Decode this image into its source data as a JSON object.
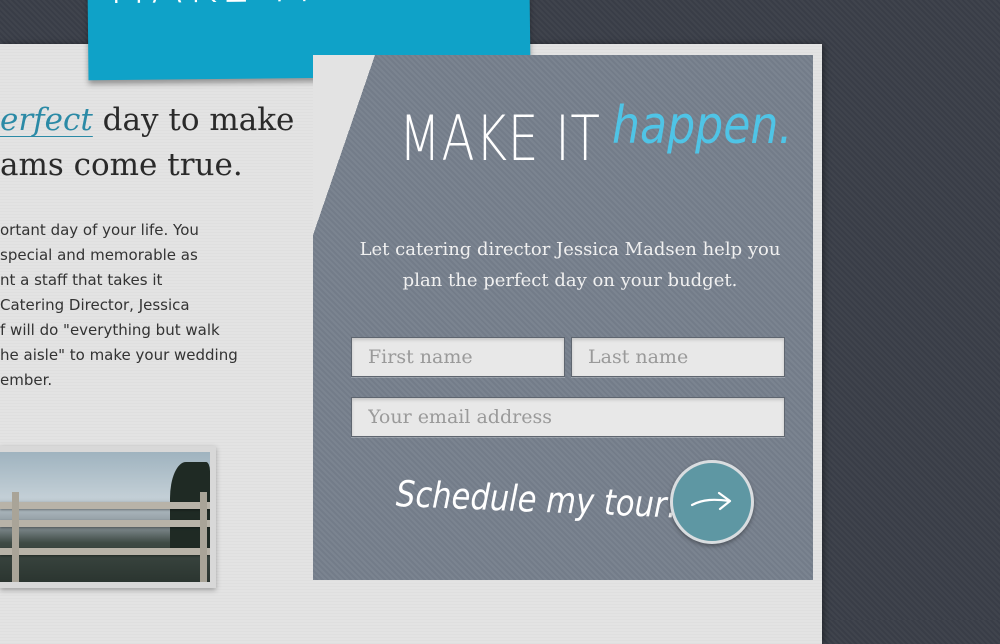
{
  "banner": {
    "text": "MAKE IT"
  },
  "headline": {
    "accent": "erfect",
    "line1_rest": " day to make",
    "line2": "ams come true."
  },
  "body_lines": [
    "ortant day of your life.  You",
    "special and memorable as",
    "nt a staff that takes it",
    "Catering Director, Jessica",
    "f will do \"everything but walk",
    "he aisle\" to make your wedding",
    "ember."
  ],
  "panel": {
    "title_main": "MAKE IT",
    "title_accent": "happen.",
    "intro_line1": "Let catering director Jessica Madsen help you",
    "intro_line2": "plan the perfect day on your budget."
  },
  "form": {
    "first_name_placeholder": "First name",
    "last_name_placeholder": "Last name",
    "email_placeholder": "Your email address",
    "cta_label": "Schedule my tour!",
    "submit_icon": "arrow-right-icon"
  },
  "colors": {
    "accent_blue": "#0fa2c8",
    "title_accent": "#4fc4e6",
    "panel_bg": "#77808d",
    "button_bg": "#5e97a3"
  }
}
